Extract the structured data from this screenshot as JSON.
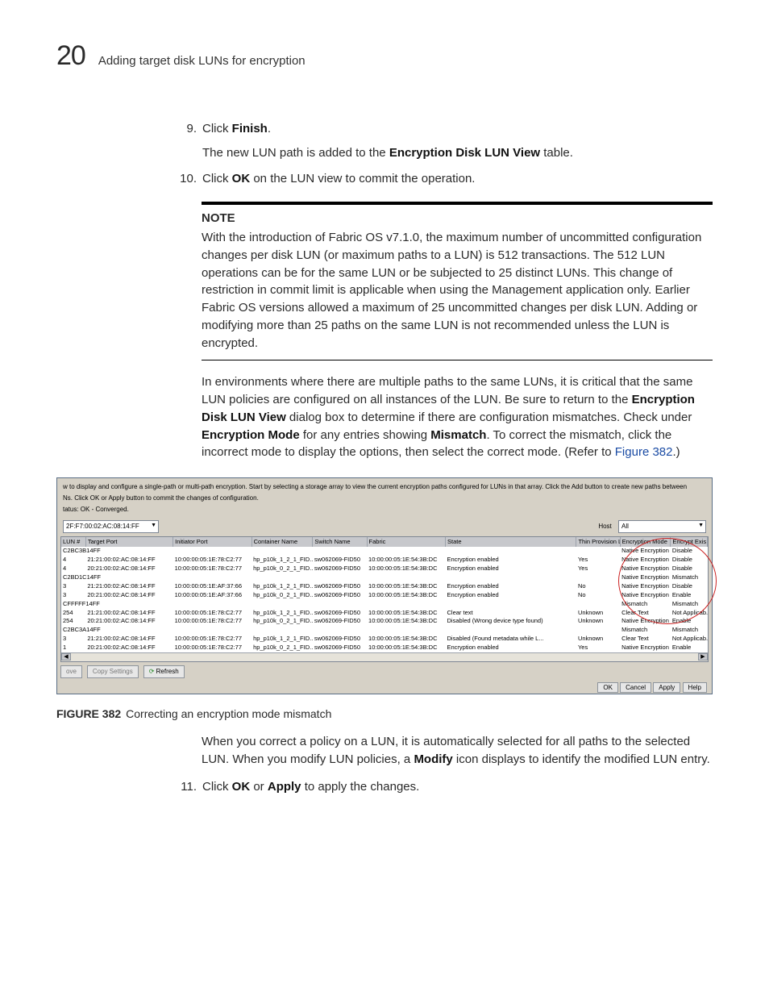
{
  "header": {
    "page_number": "20",
    "title": "Adding target disk LUNs for encryption"
  },
  "steps": {
    "s9_num": "9.",
    "s9_a": "Click ",
    "s9_b": "Finish",
    "s9_c": ".",
    "s9_para": "The new LUN path is added to the ",
    "s9_bold": "Encryption Disk LUN View",
    "s9_para_end": " table.",
    "s10_num": "10.",
    "s10_a": "Click ",
    "s10_b": "OK",
    "s10_c": " on the LUN view to commit the operation.",
    "s11_num": "11.",
    "s11_a": "Click ",
    "s11_b": "OK",
    "s11_c": " or ",
    "s11_d": "Apply",
    "s11_e": " to apply the changes."
  },
  "note": {
    "label": "NOTE",
    "body": "With the introduction of Fabric OS v7.1.0, the maximum number of uncommitted configuration changes per disk LUN (or maximum paths to a LUN) is 512 transactions. The 512 LUN operations can be for the same LUN or be subjected to 25 distinct LUNs. This change of restriction in commit limit is applicable when using the Management application only. Earlier Fabric OS versions allowed a maximum of 25 uncommitted changes per disk LUN. Adding or modifying more than 25 paths on the same LUN is not recommended unless the LUN is encrypted."
  },
  "paragraph_after": {
    "t1": "In environments where there are multiple paths to the same LUNs, it is critical that the same LUN policies are configured on all instances of the LUN. Be sure to return to the ",
    "b1": "Encryption Disk LUN View",
    "t2": " dialog box to determine if there are configuration mismatches. Check under ",
    "b2": "Encryption Mode",
    "t3": " for any entries showing ",
    "b3": "Mismatch",
    "t4": ". To correct the mismatch, click the incorrect mode to display the options, then select the correct mode. (Refer to ",
    "link": "Figure 382",
    "t5": ".)"
  },
  "screenshot": {
    "help_line1": "w to display and configure a single-path or multi-path encryption. Start by selecting a storage array to view the current encryption paths configured for LUNs in that array. Click the Add button to create new paths between",
    "help_line2": "Ns. Click OK or Apply button to commit the changes of configuration.",
    "status": "tatus: OK - Converged.",
    "selector": "2F:F7:00:02:AC:08:14:FF",
    "host_label": "Host",
    "host_value": "All",
    "headers": [
      "LUN #",
      "Target Port",
      "Initiator Port",
      "Container Name",
      "Switch Name",
      "Fabric",
      "State",
      "Thin Provision LUN",
      "Encryption Mode",
      "Encrypt Exis"
    ],
    "groups": [
      {
        "label": "C2BC3B14FF",
        "em": "Native Encryption",
        "ee": "Disable"
      },
      {
        "label": "C2BD1C14FF",
        "em": "Native Encryption",
        "ee": "Mismatch"
      },
      {
        "label": "CFFFFF14FF",
        "em": "Mismatch",
        "ee": "Mismatch"
      },
      {
        "label": "C2BC3A14FF",
        "em": "Mismatch",
        "ee": "Mismatch"
      }
    ],
    "rows": [
      {
        "g": 0,
        "lun": "4",
        "tp": "21:21:00:02:AC:08:14:FF",
        "ip": "10:00:00:05:1E:78:C2:77",
        "cn": "hp_p10k_1_2_1_FID...",
        "sn": "sw062069-FID50",
        "fb": "10:00:00:05:1E:54:3B:DC",
        "st": "Encryption enabled",
        "tpl": "Yes",
        "em": "Native Encryption",
        "ee": "Disable"
      },
      {
        "g": 0,
        "lun": "4",
        "tp": "20:21:00:02:AC:08:14:FF",
        "ip": "10:00:00:05:1E:78:C2:77",
        "cn": "hp_p10k_0_2_1_FID...",
        "sn": "sw062069-FID50",
        "fb": "10:00:00:05:1E:54:3B:DC",
        "st": "Encryption enabled",
        "tpl": "Yes",
        "em": "Native Encryption",
        "ee": "Disable"
      },
      {
        "g": 1,
        "lun": "3",
        "tp": "21:21:00:02:AC:08:14:FF",
        "ip": "10:00:00:05:1E:AF:37:66",
        "cn": "hp_p10k_1_2_1_FID...",
        "sn": "sw062069-FID50",
        "fb": "10:00:00:05:1E:54:3B:DC",
        "st": "Encryption enabled",
        "tpl": "No",
        "em": "Native Encryption",
        "ee": "Disable"
      },
      {
        "g": 1,
        "lun": "3",
        "tp": "20:21:00:02:AC:08:14:FF",
        "ip": "10:00:00:05:1E:AF:37:66",
        "cn": "hp_p10k_0_2_1_FID...",
        "sn": "sw062069-FID50",
        "fb": "10:00:00:05:1E:54:3B:DC",
        "st": "Encryption enabled",
        "tpl": "No",
        "em": "Native Encryption",
        "ee": "Enable"
      },
      {
        "g": 2,
        "lun": "254",
        "tp": "21:21:00:02:AC:08:14:FF",
        "ip": "10:00:00:05:1E:78:C2:77",
        "cn": "hp_p10k_1_2_1_FID...",
        "sn": "sw062069-FID50",
        "fb": "10:00:00:05:1E:54:3B:DC",
        "st": "Clear text",
        "tpl": "Unknown",
        "em": "Clear Text",
        "ee": "Not Applicab..."
      },
      {
        "g": 2,
        "lun": "254",
        "tp": "20:21:00:02:AC:08:14:FF",
        "ip": "10:00:00:05:1E:78:C2:77",
        "cn": "hp_p10k_0_2_1_FID...",
        "sn": "sw062069-FID50",
        "fb": "10:00:00:05:1E:54:3B:DC",
        "st": "Disabled (Wrong device type found)",
        "tpl": "Unknown",
        "em": "Native Encryption",
        "ee": "Enable"
      },
      {
        "g": 3,
        "lun": "3",
        "tp": "21:21:00:02:AC:08:14:FF",
        "ip": "10:00:00:05:1E:78:C2:77",
        "cn": "hp_p10k_1_2_1_FID...",
        "sn": "sw062069-FID50",
        "fb": "10:00:00:05:1E:54:3B:DC",
        "st": "Disabled (Found metadata while L...",
        "tpl": "Unknown",
        "em": "Clear Text",
        "ee": "Not Applicab..."
      },
      {
        "g": 3,
        "lun": "1",
        "tp": "20:21:00:02:AC:08:14:FF",
        "ip": "10:00:00:05:1E:78:C2:77",
        "cn": "hp_p10k_0_2_1_FID...",
        "sn": "sw062069-FID50",
        "fb": "10:00:00:05:1E:54:3B:DC",
        "st": "Encryption enabled",
        "tpl": "Yes",
        "em": "Native Encryption",
        "ee": "Enable"
      }
    ],
    "btn_ove": "ove",
    "btn_copy": "Copy Settings",
    "btn_refresh": "Refresh",
    "dlg_ok": "OK",
    "dlg_cancel": "Cancel",
    "dlg_apply": "Apply",
    "dlg_help": "Help"
  },
  "figure": {
    "label": "FIGURE 382",
    "caption": "Correcting an encryption mode mismatch",
    "after1": "When you correct a policy on a LUN, it is automatically selected for all paths to the selected LUN. When you modify LUN policies, a ",
    "after_b": "Modify",
    "after2": " icon displays to identify the modified LUN entry."
  }
}
